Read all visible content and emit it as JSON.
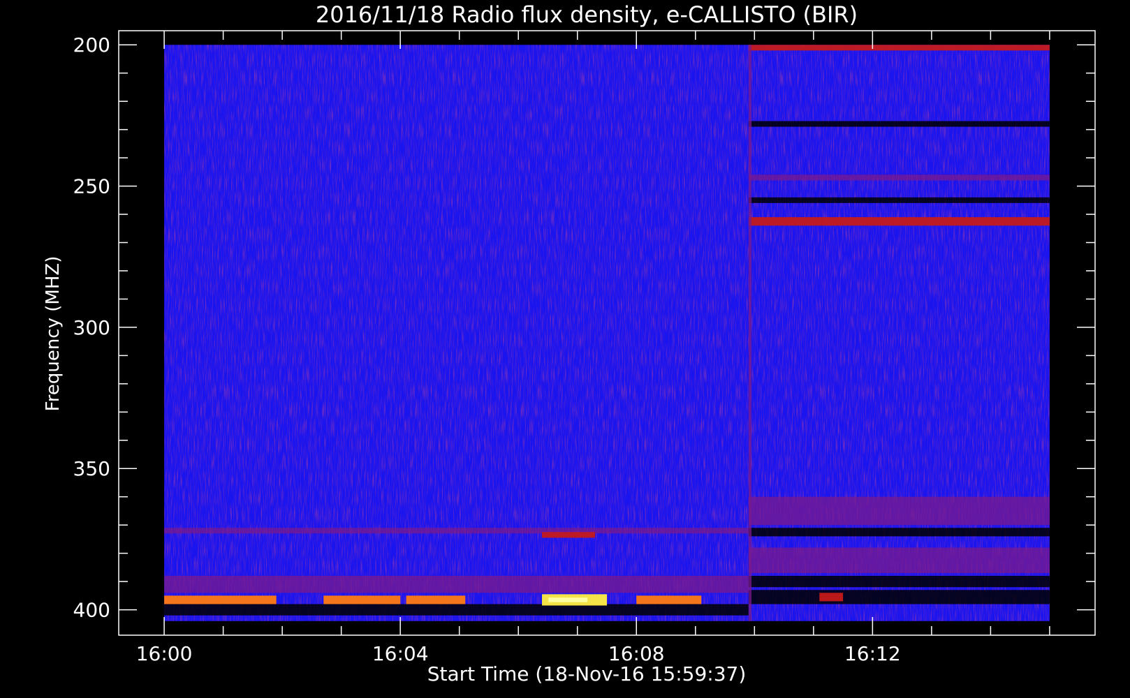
{
  "chart_data": {
    "type": "heatmap",
    "title": "2016/11/18  Radio flux density, e-CALLISTO (BIR)",
    "xlabel": "Start Time (18-Nov-16 15:59:37)",
    "ylabel": "Frequency (MHZ)",
    "x_ticks": [
      "16:00",
      "16:04",
      "16:08",
      "16:12"
    ],
    "x_tick_minutes": [
      0,
      4,
      8,
      12
    ],
    "x_minor_every_min": 1,
    "xlim_min": [
      -0.77,
      15.77
    ],
    "data_x_min": [
      0,
      15
    ],
    "y_ticks": [
      200,
      250,
      300,
      350,
      400
    ],
    "y_minor_every_mhz": 10,
    "ylim": [
      195,
      409
    ],
    "data_y": [
      200,
      404
    ],
    "y_reversed": true,
    "colors": {
      "background": "#000000",
      "frame": "#ffffff",
      "base": "#1a14ee",
      "weak_emission": "#7a1a8c",
      "medium_emission": "#c41a1a",
      "strong_emission": "#ff7a10",
      "peak_emission": "#ffee40",
      "dark": "#000000"
    },
    "features": [
      {
        "kind": "band",
        "t": [
          0,
          9.9
        ],
        "f": [
          371,
          373
        ],
        "level": "weak"
      },
      {
        "kind": "band",
        "t": [
          6.4,
          7.3
        ],
        "f": [
          372.5,
          374.5
        ],
        "level": "medium"
      },
      {
        "kind": "band",
        "t": [
          0,
          9.9
        ],
        "f": [
          388,
          394
        ],
        "level": "weak"
      },
      {
        "kind": "band",
        "t": [
          0,
          9.9
        ],
        "f": [
          398,
          402
        ],
        "level": "dark"
      },
      {
        "kind": "burst",
        "t": [
          0,
          1.9
        ],
        "f": [
          395,
          398
        ],
        "level": "strong"
      },
      {
        "kind": "burst",
        "t": [
          2.7,
          4.0
        ],
        "f": [
          395,
          398
        ],
        "level": "strong"
      },
      {
        "kind": "burst",
        "t": [
          4.1,
          5.1
        ],
        "f": [
          395,
          398
        ],
        "level": "strong"
      },
      {
        "kind": "burst",
        "t": [
          6.4,
          7.5
        ],
        "f": [
          394.5,
          398.5
        ],
        "level": "peak"
      },
      {
        "kind": "burst",
        "t": [
          8.0,
          9.1
        ],
        "f": [
          395,
          398
        ],
        "level": "strong"
      },
      {
        "kind": "band",
        "t": [
          9.9,
          15
        ],
        "f": [
          200,
          202
        ],
        "level": "medium"
      },
      {
        "kind": "band",
        "t": [
          9.9,
          15
        ],
        "f": [
          227,
          229
        ],
        "level": "dark"
      },
      {
        "kind": "band",
        "t": [
          9.9,
          15
        ],
        "f": [
          246,
          248
        ],
        "level": "weak"
      },
      {
        "kind": "band",
        "t": [
          9.9,
          15
        ],
        "f": [
          254,
          256
        ],
        "level": "dark"
      },
      {
        "kind": "band",
        "t": [
          9.9,
          15
        ],
        "f": [
          261,
          264
        ],
        "level": "medium"
      },
      {
        "kind": "band",
        "t": [
          9.9,
          15
        ],
        "f": [
          360,
          370
        ],
        "level": "weak"
      },
      {
        "kind": "band",
        "t": [
          9.9,
          15
        ],
        "f": [
          371,
          374
        ],
        "level": "dark"
      },
      {
        "kind": "band",
        "t": [
          9.9,
          15
        ],
        "f": [
          378,
          387
        ],
        "level": "weak"
      },
      {
        "kind": "band",
        "t": [
          9.9,
          15
        ],
        "f": [
          388,
          392
        ],
        "level": "dark"
      },
      {
        "kind": "band",
        "t": [
          9.9,
          15
        ],
        "f": [
          393,
          398
        ],
        "level": "dark"
      },
      {
        "kind": "burst",
        "t": [
          11.1,
          11.5
        ],
        "f": [
          394,
          397
        ],
        "level": "medium"
      },
      {
        "kind": "line",
        "t": [
          9.9,
          9.95
        ],
        "f": [
          200,
          404
        ],
        "level": "weak"
      }
    ]
  }
}
